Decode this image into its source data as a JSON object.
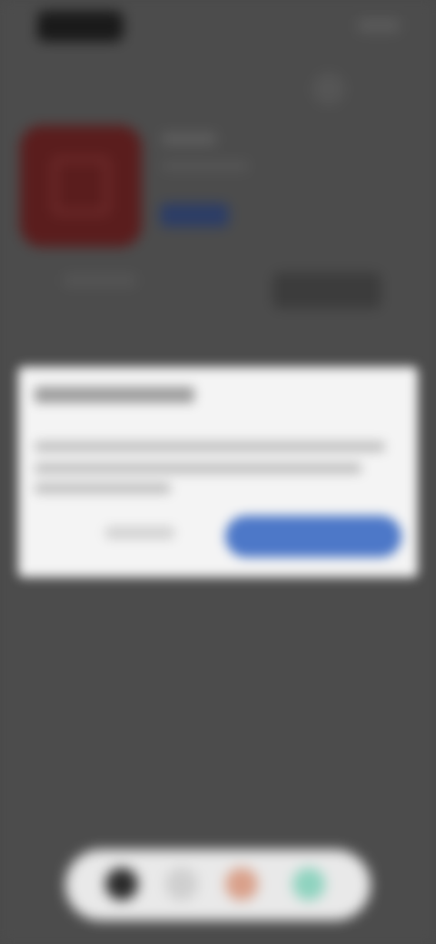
{
  "status_bar": {},
  "app": {},
  "dialog": {},
  "dock": {
    "icons": [
      "phone-icon",
      "messages-icon",
      "browser-icon",
      "store-icon"
    ]
  },
  "colors": {
    "scrim": "#4a4a4a",
    "dialog_bg": "#f4f4f4",
    "accent": "#4d78c8",
    "app_icon": "#5a1d1d"
  }
}
